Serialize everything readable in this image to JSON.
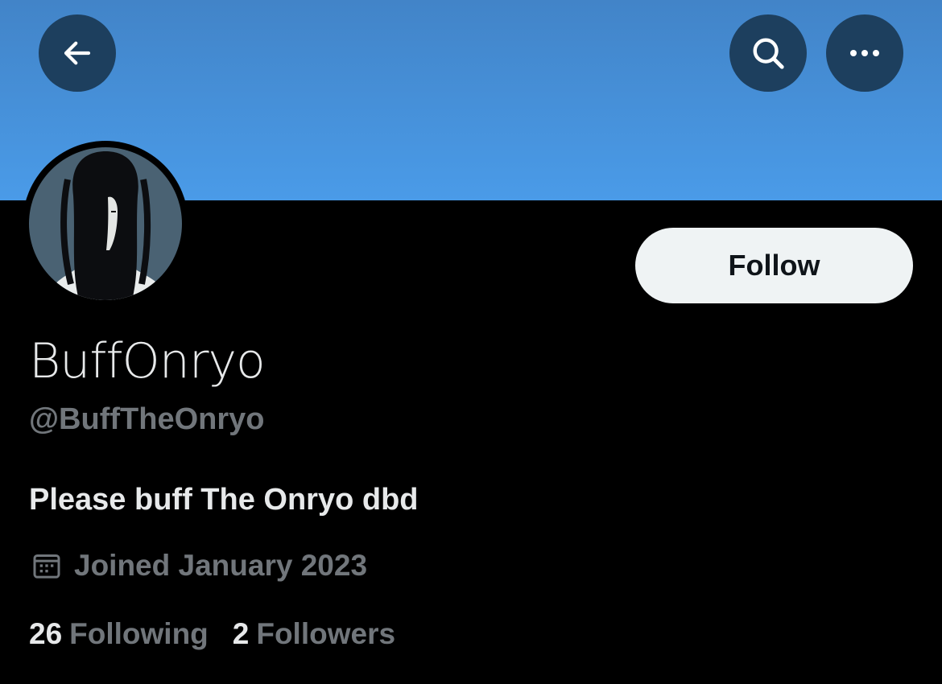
{
  "colors": {
    "banner": "#4a9be8",
    "background": "#000000",
    "text_primary": "#e7e9ea",
    "text_secondary": "#71767b",
    "follow_button_bg": "#eff3f4",
    "icon_button_bg": "#1d3f5e"
  },
  "header": {
    "back_icon": "arrow-left-icon",
    "search_icon": "search-icon",
    "more_icon": "more-horizontal-icon"
  },
  "profile": {
    "display_name": "BuffOnryo",
    "handle": "@BuffTheOnryo",
    "bio": "Please buff The Onryo dbd",
    "joined": "Joined January 2023",
    "joined_icon": "calendar-icon",
    "follow_label": "Follow"
  },
  "stats": {
    "following_count": "26",
    "following_label": "Following",
    "followers_count": "2",
    "followers_label": "Followers"
  }
}
